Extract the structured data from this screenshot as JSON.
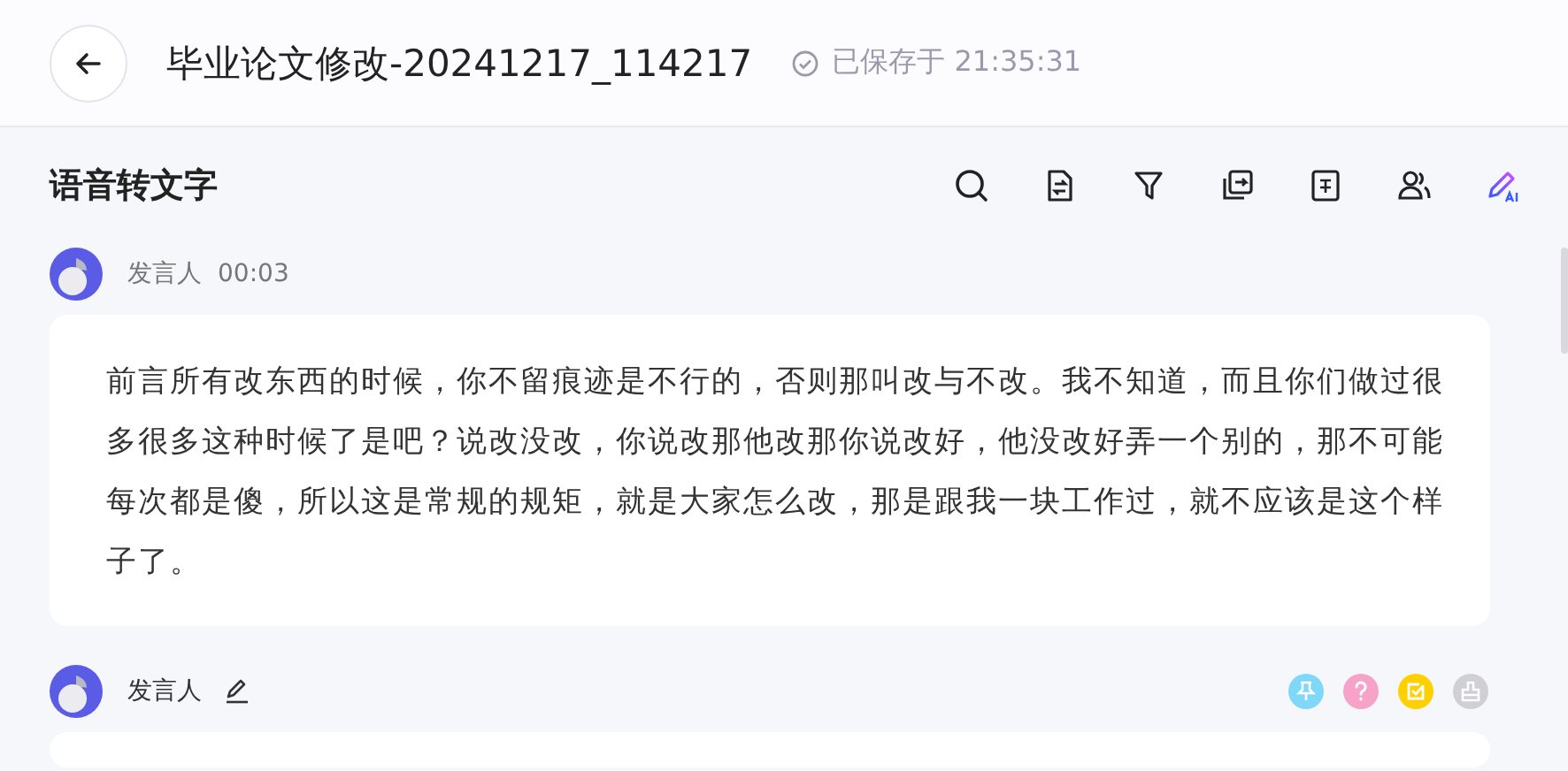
{
  "header": {
    "title": "毕业论文修改-20241217_114217",
    "save_status": "已保存于 21:35:31"
  },
  "panel": {
    "title": "语音转文字"
  },
  "segments": [
    {
      "speaker": "发言人",
      "time": "00:03",
      "editable": false,
      "text": "前言所有改东西的时候，你不留痕迹是不行的，否则那叫改与不改。我不知道，而且你们做过很多很多这种时候了是吧？说改没改，你说改那他改那你说改好，他没改好弄一个别的，那不可能每次都是傻，所以这是常规的规矩，就是大家怎么改，那是跟我一块工作过，就不应该是这个样子了。"
    },
    {
      "speaker": "发言人",
      "editable": true,
      "markers": [
        {
          "kind": "pin",
          "color": "#7fd8f7"
        },
        {
          "kind": "question",
          "color": "#f7a2c9"
        },
        {
          "kind": "todo",
          "color": "#ffd000"
        },
        {
          "kind": "erase",
          "color": "#cfcfd4"
        }
      ]
    }
  ]
}
